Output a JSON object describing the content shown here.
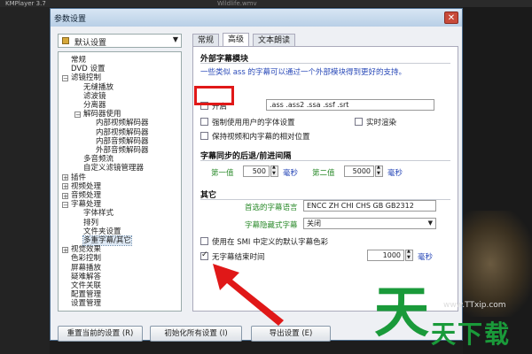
{
  "background": {
    "player_title": "KMPlayer 3.7",
    "file_title": "Wildlife.wmv"
  },
  "dialog": {
    "title": "参数设置",
    "close_label": "✕",
    "preset": "默认设置"
  },
  "tree": [
    {
      "label": "常规",
      "indent": 0,
      "exp": "",
      "row": 0
    },
    {
      "label": "DVD 设置",
      "indent": 0,
      "exp": "",
      "row": 1
    },
    {
      "label": "滤镜控制",
      "indent": 0,
      "exp": "−",
      "row": 2
    },
    {
      "label": "无缝播放",
      "indent": 1,
      "exp": "",
      "row": 3
    },
    {
      "label": "滤波镜",
      "indent": 1,
      "exp": "",
      "row": 4
    },
    {
      "label": "分离器",
      "indent": 1,
      "exp": "",
      "row": 5
    },
    {
      "label": "解码器使用",
      "indent": 1,
      "exp": "−",
      "row": 6
    },
    {
      "label": "内部视频解码器",
      "indent": 2,
      "exp": "",
      "row": 7
    },
    {
      "label": "内部视频解码器",
      "indent": 2,
      "exp": "",
      "row": 8
    },
    {
      "label": "内部音频解码器",
      "indent": 2,
      "exp": "",
      "row": 9
    },
    {
      "label": "外部音频解码器",
      "indent": 2,
      "exp": "",
      "row": 10
    },
    {
      "label": "多音频流",
      "indent": 1,
      "exp": "",
      "row": 11
    },
    {
      "label": "自定义滤镜管理器",
      "indent": 1,
      "exp": "",
      "row": 12
    },
    {
      "label": "插件",
      "indent": 0,
      "exp": "+",
      "row": 13
    },
    {
      "label": "视频处理",
      "indent": 0,
      "exp": "+",
      "row": 14
    },
    {
      "label": "音频处理",
      "indent": 0,
      "exp": "+",
      "row": 15
    },
    {
      "label": "字幕处理",
      "indent": 0,
      "exp": "−",
      "row": 16
    },
    {
      "label": "字体样式",
      "indent": 1,
      "exp": "",
      "row": 17
    },
    {
      "label": "排列",
      "indent": 1,
      "exp": "",
      "row": 18
    },
    {
      "label": "文件夹设置",
      "indent": 1,
      "exp": "",
      "row": 19
    },
    {
      "label": "多重字幕/其它",
      "indent": 1,
      "exp": "",
      "row": 20,
      "selected": true
    },
    {
      "label": "视觉效果",
      "indent": 0,
      "exp": "+",
      "row": 21
    },
    {
      "label": "色彩控制",
      "indent": 0,
      "exp": "",
      "row": 22
    },
    {
      "label": "屏幕播放",
      "indent": 0,
      "exp": "",
      "row": 23
    },
    {
      "label": "疑难解答",
      "indent": 0,
      "exp": "",
      "row": 24
    },
    {
      "label": "文件关联",
      "indent": 0,
      "exp": "",
      "row": 25
    },
    {
      "label": "配置管理",
      "indent": 0,
      "exp": "",
      "row": 26
    },
    {
      "label": "设置管理",
      "indent": 0,
      "exp": "",
      "row": 27
    }
  ],
  "tabs": [
    "常规",
    "高级",
    "文本朗读"
  ],
  "active_tab": 1,
  "external": {
    "section": "外部字幕模块",
    "desc": "一些类似 ass 的字幕可以通过一个外部模块得到更好的支持。",
    "enable_label": "开启",
    "enable_checked": false,
    "extensions": ".ass .ass2 .ssa .ssf .srt",
    "force_label": "强制使用用户的字体设置",
    "force_checked": false,
    "realtime_label": "实时渲染",
    "realtime_checked": false,
    "keep_label": "保持视频和内字幕的相对位置",
    "keep_checked": false
  },
  "sync": {
    "section": "字幕同步的后退/前进间隔",
    "first_label": "第一值",
    "first_value": "500",
    "first_unit": "毫秒",
    "second_label": "第二值",
    "second_value": "5000",
    "second_unit": "毫秒"
  },
  "other": {
    "section": "其它",
    "lang_label": "首选的字幕语言",
    "lang_value": "ENCC ZH CHI CHS GB GB2312",
    "style_label": "字幕隐藏式字幕",
    "style_value": "关闭",
    "smi_label": "使用在 SMI 中定义的默认字幕色彩",
    "smi_checked": false,
    "noend_label": "无字幕结束时间",
    "noend_checked": true,
    "noend_value": "1000",
    "noend_unit": "毫秒"
  },
  "buttons": {
    "reset": "重置当前的设置 (R)",
    "init": "初始化所有设置 (I)",
    "export": "导出设置 (E)"
  },
  "watermark": {
    "big": "天",
    "small": "天下载",
    "url": "www.TTxip.com"
  },
  "colors": {
    "highlight": "#e01818",
    "watermark": "#1a9a3a",
    "link_text": "#2a4ab8",
    "label_green": "#2a8a2a"
  }
}
